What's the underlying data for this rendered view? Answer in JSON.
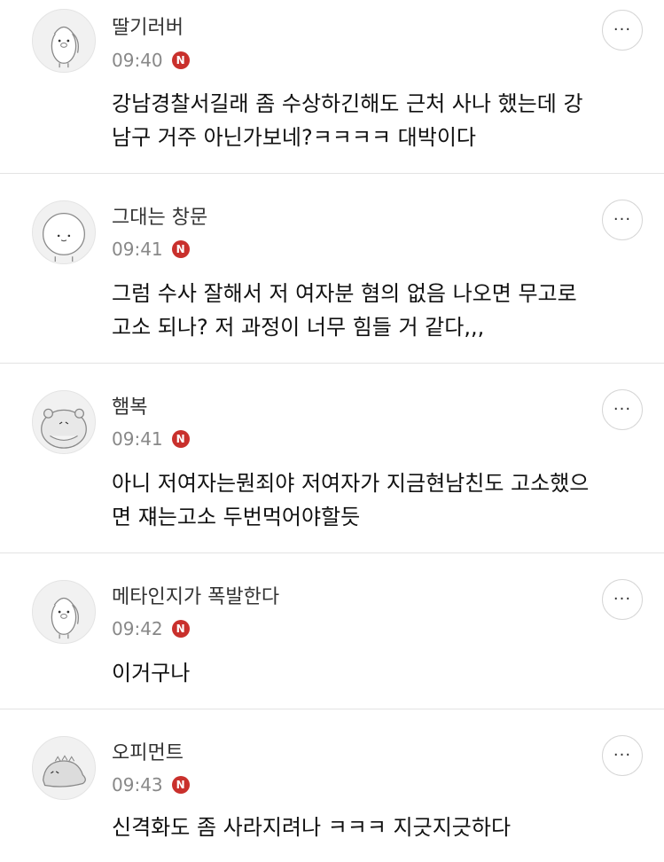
{
  "comments": [
    {
      "nickname": "딸기러버",
      "time": "09:40",
      "badge": "N",
      "text": "강남경찰서길래 좀 수상하긴해도 근처 사나 했는데 강\n남구 거주 아닌가보네?ㅋㅋㅋㅋ 대박이다",
      "avatar_icon": "duck-character-icon",
      "more_label": "···"
    },
    {
      "nickname": "그대는 창문",
      "time": "09:41",
      "badge": "N",
      "text": "그럼 수사 잘해서 저 여자분 혐의 없음 나오면 무고로\n고소 되나? 저 과정이 너무 힘들 거 같다,,,",
      "avatar_icon": "round-face-character-icon",
      "more_label": "···"
    },
    {
      "nickname": "햄복",
      "time": "09:41",
      "badge": "N",
      "text": "아니 저여자는뭔죄야 저여자가 지금현남친도 고소했으\n면 쟤는고소 두번먹어야할듯",
      "avatar_icon": "hamster-character-icon",
      "more_label": "···"
    },
    {
      "nickname": "메타인지가 폭발한다",
      "time": "09:42",
      "badge": "N",
      "text": "이거구나",
      "avatar_icon": "duck-character-icon",
      "more_label": "···"
    },
    {
      "nickname": "오피먼트",
      "time": "09:43",
      "badge": "N",
      "text": "신격화도 좀 사라지려나 ㅋㅋㅋ 지긋지긋하다",
      "avatar_icon": "dinosaur-character-icon",
      "more_label": "···"
    }
  ]
}
